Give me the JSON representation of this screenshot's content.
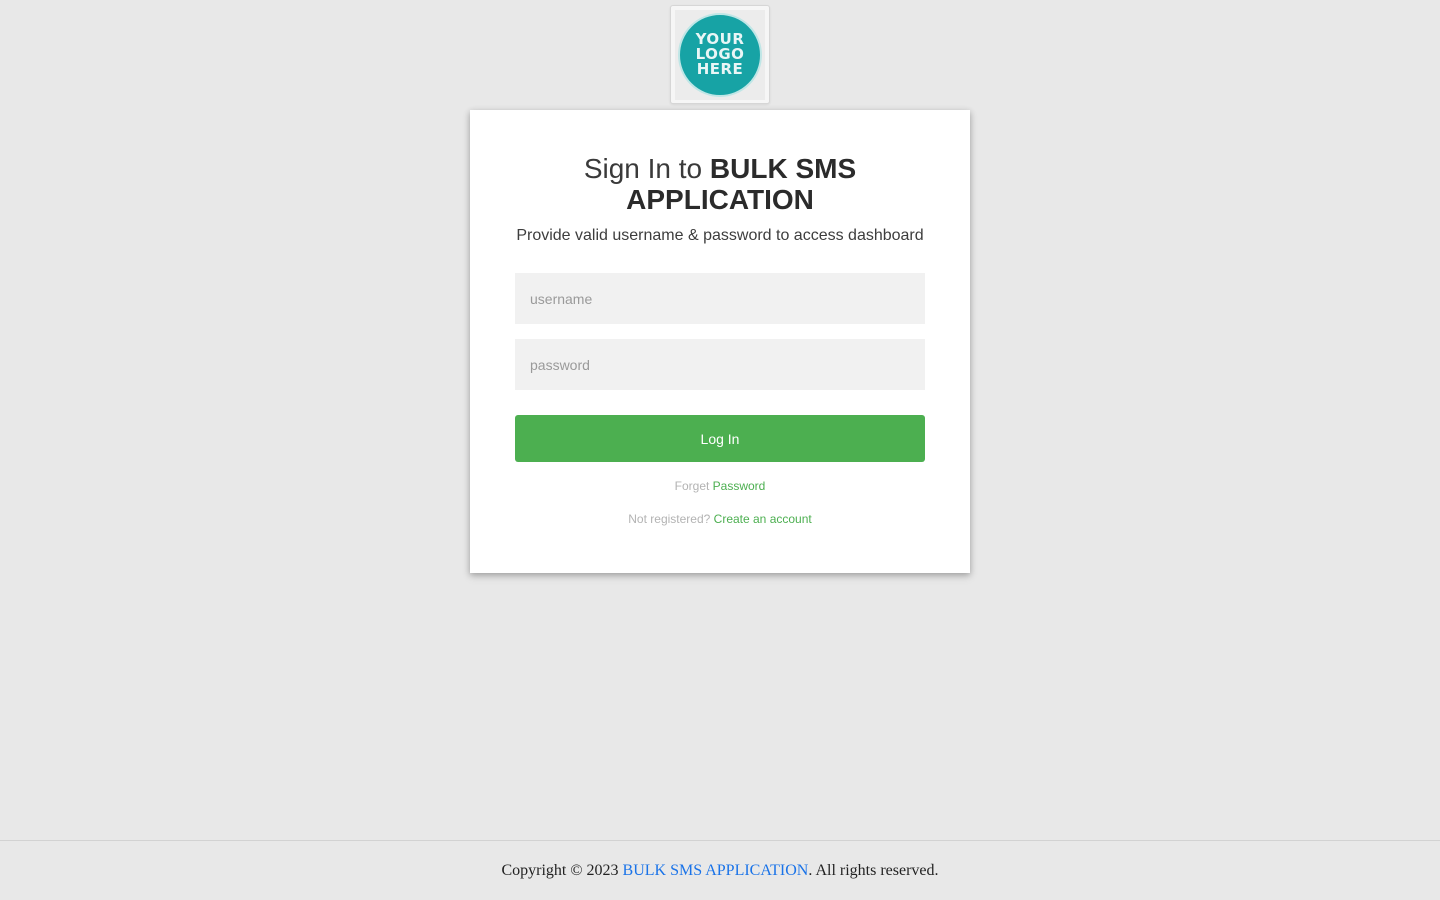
{
  "logo": {
    "line1": "YOUR",
    "line2": "LOGO",
    "line3": "HERE"
  },
  "signin": {
    "title_prefix": "Sign In to ",
    "title_brand": "BULK SMS APPLICATION",
    "subtitle": "Provide valid username & password to access dashboard",
    "username_placeholder": "username",
    "password_placeholder": "password",
    "login_label": "Log In",
    "forget_text": "Forget ",
    "forget_link": "Password",
    "register_text": "Not registered? ",
    "register_link": "Create an account"
  },
  "footer": {
    "prefix": "Copyright © 2023 ",
    "brand_link": "BULK SMS APPLICATION",
    "suffix": ". All rights reserved."
  },
  "colors": {
    "accent": "#4caf50",
    "logo": "#17a3a5",
    "footer_link": "#1a73e8",
    "background": "#e8e8e8"
  }
}
